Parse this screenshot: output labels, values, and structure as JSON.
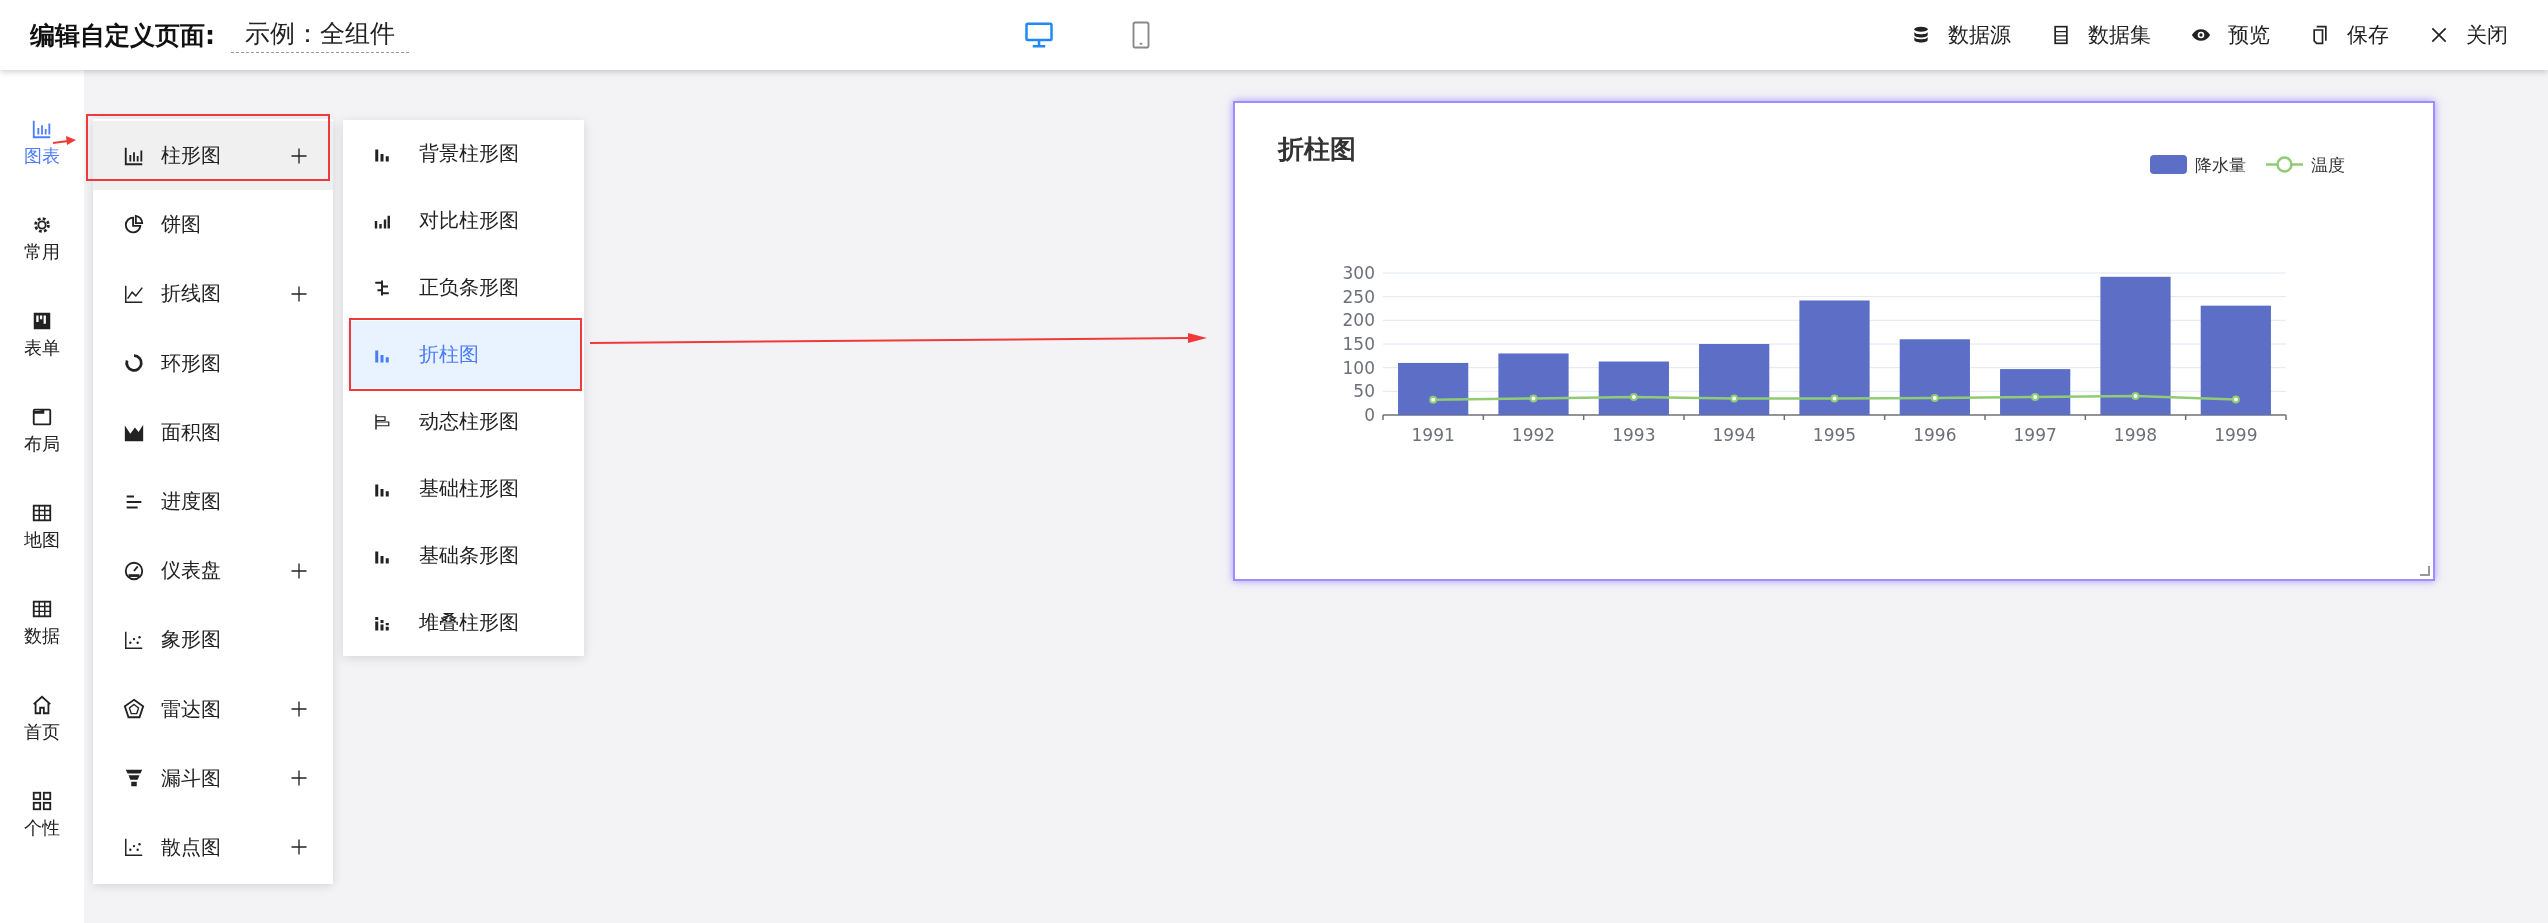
{
  "header": {
    "title": "编辑自定义页面:",
    "page_name": "示例：全组件",
    "devices": [
      {
        "kind": "desktop",
        "selected": true
      },
      {
        "kind": "mobile",
        "selected": false
      }
    ],
    "actions": [
      {
        "label": "数据源"
      },
      {
        "label": "数据集"
      },
      {
        "label": "预览"
      },
      {
        "label": "保存"
      },
      {
        "label": "关闭"
      }
    ]
  },
  "sidebar": {
    "items": [
      {
        "label": "图表",
        "selected": true
      },
      {
        "label": "常用",
        "selected": false
      },
      {
        "label": "表单",
        "selected": false
      },
      {
        "label": "布局",
        "selected": false
      },
      {
        "label": "地图",
        "selected": false
      },
      {
        "label": "数据",
        "selected": false
      },
      {
        "label": "首页",
        "selected": false
      },
      {
        "label": "个性",
        "selected": false
      }
    ]
  },
  "chart_menu": {
    "items": [
      {
        "label": "柱形图",
        "expandable": true,
        "selected": true
      },
      {
        "label": "饼图",
        "expandable": false,
        "selected": false
      },
      {
        "label": "折线图",
        "expandable": true,
        "selected": false
      },
      {
        "label": "环形图",
        "expandable": false,
        "selected": false
      },
      {
        "label": "面积图",
        "expandable": false,
        "selected": false
      },
      {
        "label": "进度图",
        "expandable": false,
        "selected": false
      },
      {
        "label": "仪表盘",
        "expandable": true,
        "selected": false
      },
      {
        "label": "象形图",
        "expandable": false,
        "selected": false
      },
      {
        "label": "雷达图",
        "expandable": true,
        "selected": false
      },
      {
        "label": "漏斗图",
        "expandable": true,
        "selected": false
      },
      {
        "label": "散点图",
        "expandable": true,
        "selected": false
      }
    ]
  },
  "submenu": {
    "items": [
      {
        "label": "背景柱形图",
        "selected": false
      },
      {
        "label": "对比柱形图",
        "selected": false
      },
      {
        "label": "正负条形图",
        "selected": false
      },
      {
        "label": "折柱图",
        "selected": true
      },
      {
        "label": "动态柱形图",
        "selected": false
      },
      {
        "label": "基础柱形图",
        "selected": false
      },
      {
        "label": "基础条形图",
        "selected": false
      },
      {
        "label": "堆叠柱形图",
        "selected": false
      }
    ]
  },
  "chart_card": {
    "chart_data": {
      "type": "bar",
      "title": "折柱图",
      "categories": [
        "1991",
        "1992",
        "1993",
        "1994",
        "1995",
        "1996",
        "1997",
        "1998",
        "1999"
      ],
      "ylim": [
        0,
        300
      ],
      "yticks": [
        0,
        50,
        100,
        150,
        200,
        250,
        300
      ],
      "stacked": false,
      "grid": true,
      "legend": "top-right",
      "series": [
        {
          "name": "降水量",
          "color": "#5d6ec6",
          "values": [
            110,
            130,
            113,
            150,
            242,
            160,
            97,
            292,
            231
          ]
        },
        {
          "name": "温度",
          "type": "line",
          "marker": "circle",
          "color": "#91cc75",
          "values": [
            32,
            35,
            38,
            35,
            35,
            36,
            38,
            40,
            33
          ]
        }
      ]
    }
  }
}
